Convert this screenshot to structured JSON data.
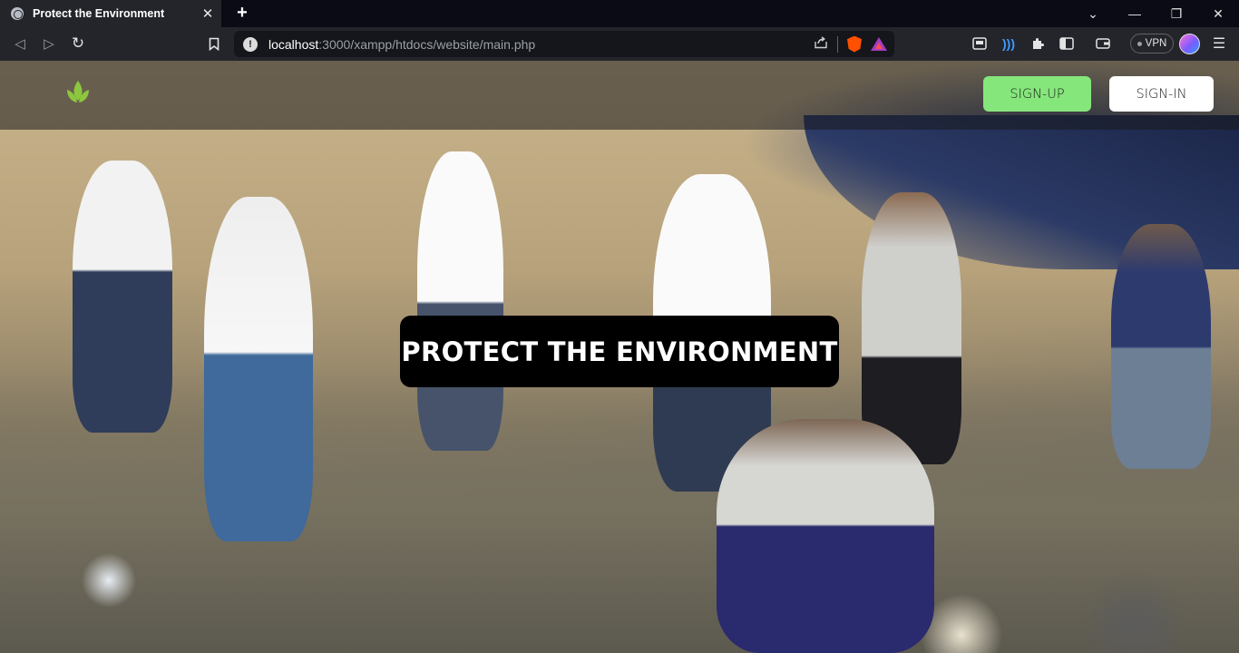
{
  "browser": {
    "tab_title": "Protect the Environment",
    "tab_close": "✕",
    "new_tab": "+",
    "url_host": "localhost",
    "url_rest": ":3000/xampp/htdocs/website/main.php",
    "vpn_label": "VPN",
    "icons": [
      "back-icon",
      "forward-icon",
      "reload-icon",
      "bookmark-icon",
      "info-icon",
      "share-icon",
      "brave-shield-icon",
      "brave-rewards-icon",
      "media-icon",
      "wifi-icon",
      "extensions-icon",
      "sidebar-icon",
      "wallet-icon",
      "profile-avatar",
      "menu-icon"
    ]
  },
  "page": {
    "signup_label": "SIGN-UP",
    "signin_label": "SIGN-IN",
    "hero_title": "PROTECT THE ENVIRONMENT",
    "colors": {
      "signup_bg": "#85e67b",
      "signin_bg": "#ffffff",
      "hero_title_bg": "#000000",
      "logo_green": "#8dc63f"
    },
    "hero_image": "volunteers cleaning up plastic waste on a beach"
  }
}
